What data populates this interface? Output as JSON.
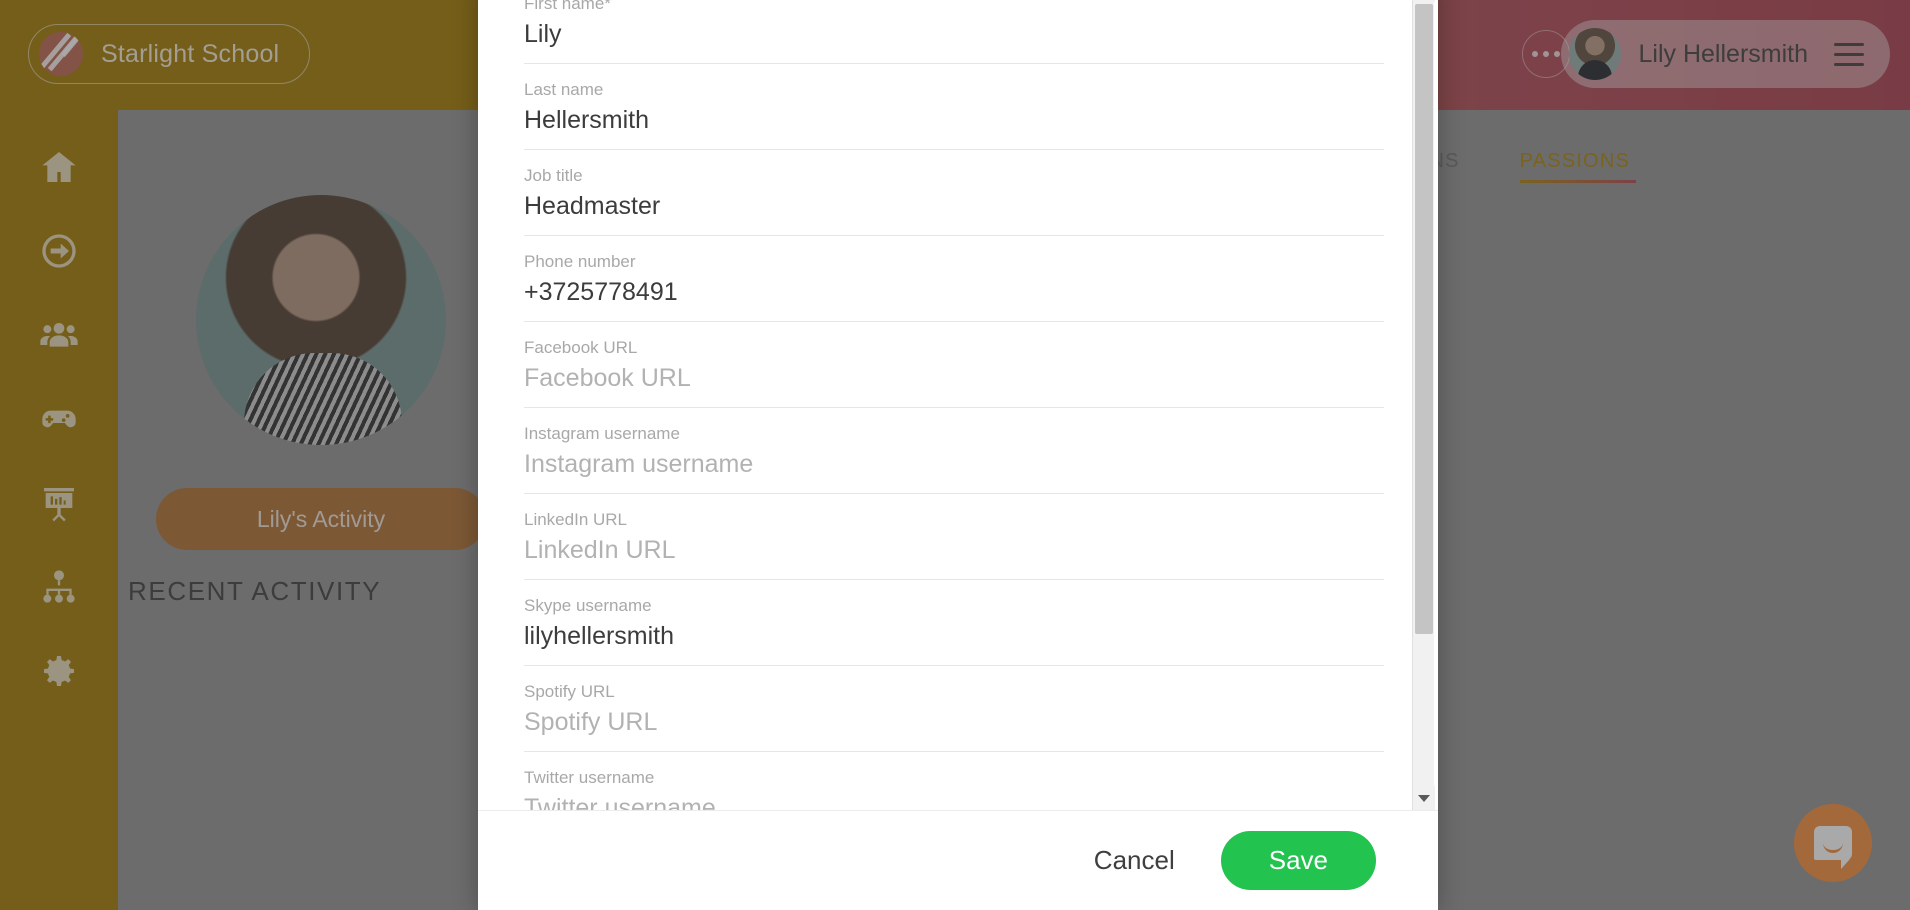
{
  "brand": {
    "name": "Starlight School",
    "logo_icon": "slash-logo-icon"
  },
  "header": {
    "more_icon": "more-dots-icon",
    "user_name": "Lily Hellersmith",
    "avatar_icon": "user-avatar",
    "menu_icon": "hamburger-menu-icon",
    "gradient_from": "#a8820f",
    "gradient_to": "#b04a5a"
  },
  "sidebar": {
    "items": [
      {
        "icon": "home-icon",
        "name": "sidebar-item-home"
      },
      {
        "icon": "arrow-circle-right-icon",
        "name": "sidebar-item-checkin"
      },
      {
        "icon": "people-group-icon",
        "name": "sidebar-item-people"
      },
      {
        "icon": "gamepad-icon",
        "name": "sidebar-item-games"
      },
      {
        "icon": "presentation-screen-icon",
        "name": "sidebar-item-presentations"
      },
      {
        "icon": "org-chart-icon",
        "name": "sidebar-item-orgchart"
      },
      {
        "icon": "gear-icon",
        "name": "sidebar-item-settings"
      }
    ]
  },
  "main": {
    "profile_photo": "profile-photo",
    "activity_button": "Lily's Activity",
    "recent_activity_heading": "RECENT ACTIVITY",
    "tabs": [
      {
        "label": "STIONS",
        "active": false
      },
      {
        "label": "PASSIONS",
        "active": true
      }
    ],
    "accent_color": "#b08a1a",
    "activity_button_color": "#b5793f"
  },
  "intercom": {
    "icon": "chat-bubble-icon",
    "color": "#f79448"
  },
  "modal": {
    "fields": [
      {
        "label": "First name",
        "required": true,
        "value": "Lily",
        "filled": true,
        "name": "first-name"
      },
      {
        "label": "Last name",
        "required": false,
        "value": "Hellersmith",
        "filled": true,
        "name": "last-name"
      },
      {
        "label": "Job title",
        "required": false,
        "value": "Headmaster",
        "filled": true,
        "name": "job-title"
      },
      {
        "label": "Phone number",
        "required": false,
        "value": "+3725778491",
        "filled": true,
        "name": "phone-number"
      },
      {
        "label": "Facebook URL",
        "required": false,
        "value": "Facebook URL",
        "filled": false,
        "name": "facebook-url"
      },
      {
        "label": "Instagram username",
        "required": false,
        "value": "Instagram username",
        "filled": false,
        "name": "instagram-username"
      },
      {
        "label": "LinkedIn URL",
        "required": false,
        "value": "LinkedIn URL",
        "filled": false,
        "name": "linkedin-url"
      },
      {
        "label": "Skype username",
        "required": false,
        "value": "lilyhellersmith",
        "filled": true,
        "name": "skype-username"
      },
      {
        "label": "Spotify URL",
        "required": false,
        "value": "Spotify URL",
        "filled": false,
        "name": "spotify-url"
      },
      {
        "label": "Twitter username",
        "required": false,
        "value": "Twitter username",
        "filled": false,
        "name": "twitter-username"
      }
    ],
    "required_marker": "*",
    "cancel_label": "Cancel",
    "save_label": "Save",
    "save_color": "#22c34e",
    "scrollbar": {
      "up_icon": "scroll-up-arrow-icon",
      "down_icon": "scroll-down-arrow-icon"
    }
  }
}
